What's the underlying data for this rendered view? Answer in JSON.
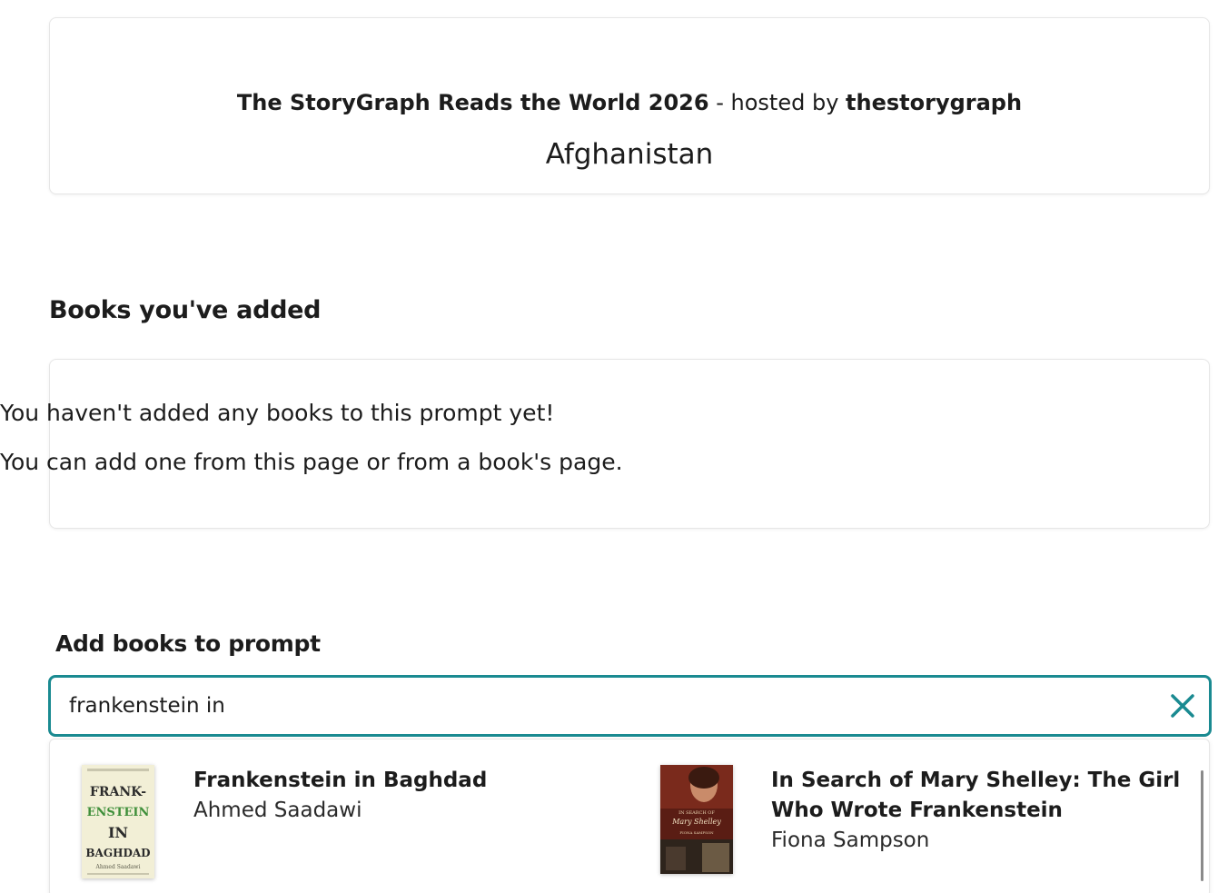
{
  "challenge": {
    "name": "The StoryGraph Reads the World 2026",
    "separator": "-",
    "hosted_by_label": "hosted by",
    "host": "thestorygraph",
    "prompt": "Afghanistan"
  },
  "books_added": {
    "heading": "Books you've added",
    "empty_line1": "You haven't added any books to this prompt yet!",
    "empty_line2": "You can add one from this page or from a book's page."
  },
  "add_books": {
    "heading": "Add books to prompt",
    "search_value": "frankenstein in",
    "clear_icon": "close-icon",
    "accent_color": "#1a8a91"
  },
  "results": [
    {
      "title": "Frankenstein in Baghdad",
      "author": "Ahmed Saadawi",
      "cover_text": [
        "FRANK-",
        "ENSTEIN",
        "IN",
        "BAGHDAD"
      ],
      "cover_author": "Ahmed Saadawi"
    },
    {
      "title": "In Search of Mary Shelley: The Girl Who Wrote Frankenstein",
      "author": "Fiona Sampson",
      "cover_text": [
        "IN SEARCH OF",
        "Mary Shelley",
        "FIONA SAMPSON"
      ]
    }
  ]
}
